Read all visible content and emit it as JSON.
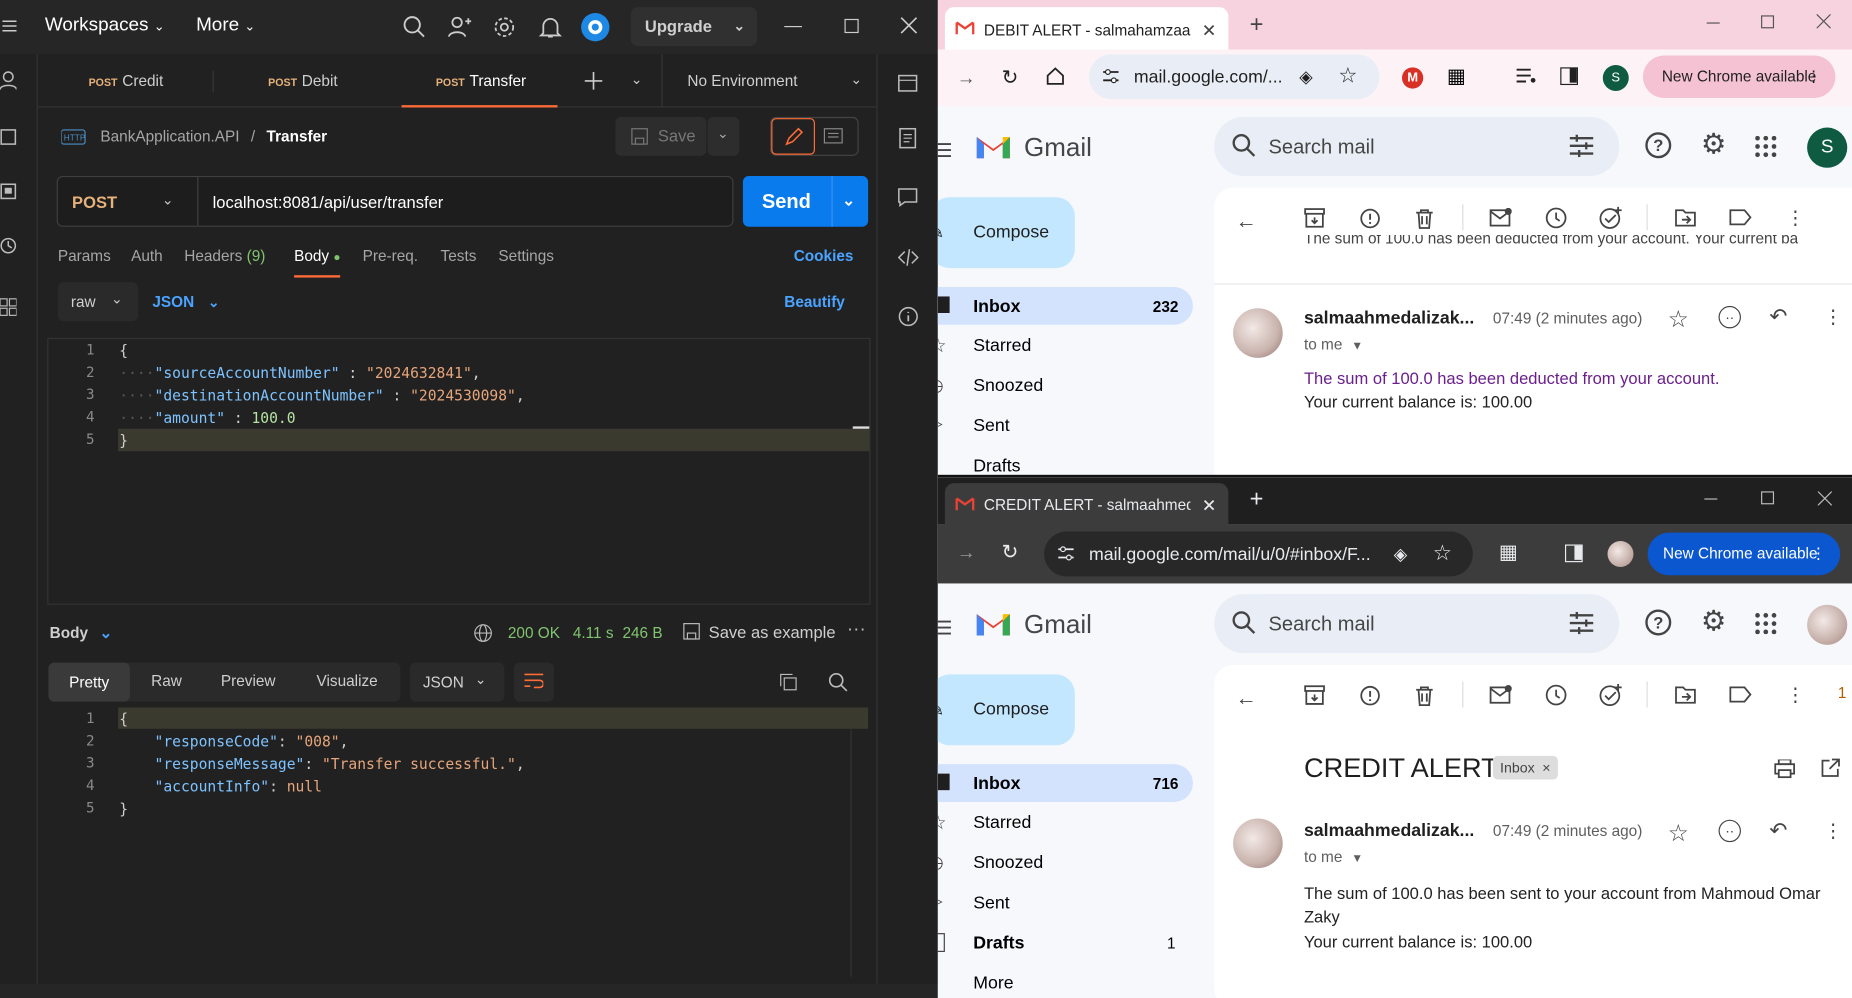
{
  "postman": {
    "header": {
      "workspaces": "Workspaces",
      "more": "More",
      "upgrade": "Upgrade"
    },
    "tabs": [
      {
        "method": "POST",
        "label": "Credit"
      },
      {
        "method": "POST",
        "label": "Debit"
      },
      {
        "method": "POST",
        "label": "Transfer"
      }
    ],
    "environment": "No Environment",
    "breadcrumb": {
      "collection": "BankApplication.API",
      "separator": "/",
      "request": "Transfer"
    },
    "save_label": "Save",
    "request": {
      "method": "POST",
      "url": "localhost:8081/api/user/transfer",
      "send_label": "Send"
    },
    "request_tabs": {
      "params": "Params",
      "auth": "Auth",
      "headers": "Headers",
      "headers_count": "(9)",
      "body": "Body",
      "prereq": "Pre-req.",
      "tests": "Tests",
      "settings": "Settings",
      "cookies": "Cookies"
    },
    "body_mode": "raw",
    "body_lang": "JSON",
    "beautify": "Beautify",
    "request_body_lines": [
      {
        "num": "1",
        "text": "{"
      },
      {
        "num": "2",
        "key": "\"sourceAccountNumber\"",
        "sep": " : ",
        "val": "\"2024632841\"",
        "tail": ","
      },
      {
        "num": "3",
        "key": "\"destinationAccountNumber\"",
        "sep": " : ",
        "val": "\"2024530098\"",
        "tail": ","
      },
      {
        "num": "4",
        "key": "\"amount\"",
        "sep": " : ",
        "val": "100.0",
        "tail": ""
      },
      {
        "num": "5",
        "text": "}"
      }
    ],
    "response": {
      "label": "Body",
      "status": "200 OK",
      "time": "4.11 s",
      "size": "246 B",
      "save_example": "Save as example",
      "tabs": {
        "pretty": "Pretty",
        "raw": "Raw",
        "preview": "Preview",
        "visualize": "Visualize",
        "format": "JSON"
      },
      "lines": [
        {
          "num": "1",
          "text": "{"
        },
        {
          "num": "2",
          "key": "\"responseCode\"",
          "sep": ": ",
          "val": "\"008\"",
          "tail": ","
        },
        {
          "num": "3",
          "key": "\"responseMessage\"",
          "sep": ": ",
          "val": "\"Transfer successful.\"",
          "tail": ","
        },
        {
          "num": "4",
          "key": "\"accountInfo\"",
          "sep": ": ",
          "val": "null",
          "tail": ""
        },
        {
          "num": "5",
          "text": "}"
        }
      ]
    }
  },
  "gmail_top": {
    "tab_title": "DEBIT ALERT - salmahamzaahm",
    "url": "mail.google.com/...",
    "new_chrome": "New Chrome available",
    "profile_initial": "S",
    "logo": "Gmail",
    "search_placeholder": "Search mail",
    "compose": "Compose",
    "nav": [
      {
        "label": "Inbox",
        "count": "232"
      },
      {
        "label": "Starred"
      },
      {
        "label": "Snoozed"
      },
      {
        "label": "Sent"
      },
      {
        "label": "Drafts"
      }
    ],
    "truncated_line": "The sum of 100.0 has been deducted from your account. Your current ba",
    "sender": "salmaahmedalizak...",
    "time": "07:49 (2 minutes ago)",
    "to": "to me",
    "body_line1": "The sum of 100.0 has been deducted from your account.",
    "body_line2": "Your current balance is: 100.00"
  },
  "gmail_bottom": {
    "tab_title": "CREDIT ALERT - salmaahmedali",
    "url": "mail.google.com/mail/u/0/#inbox/F...",
    "new_chrome": "New Chrome available",
    "logo": "Gmail",
    "search_placeholder": "Search mail",
    "compose": "Compose",
    "nav": [
      {
        "label": "Inbox",
        "count": "716"
      },
      {
        "label": "Starred"
      },
      {
        "label": "Snoozed"
      },
      {
        "label": "Sent"
      },
      {
        "label": "Drafts",
        "count": "1"
      },
      {
        "label": "More"
      }
    ],
    "subject": "CREDIT ALERT",
    "label_chip": "Inbox",
    "sender": "salmaahmedalizak...",
    "time": "07:49 (2 minutes ago)",
    "to": "to me",
    "body_line1": "The sum of 100.0 has been sent to your account from Mahmoud Omar",
    "body_line1b": "Zaky",
    "body_line2": "Your current balance is: 100.00",
    "toolbar_extra": "1"
  },
  "colors": {
    "postman_bg": "#212121",
    "postman_accent": "#ff6c37",
    "send_blue": "#097bed",
    "gmail_pink": "#f8d7e3",
    "gmail_dark": "#202124",
    "inbox_sel": "#d3e3fd",
    "new_chrome_blue": "#0b57d0"
  }
}
